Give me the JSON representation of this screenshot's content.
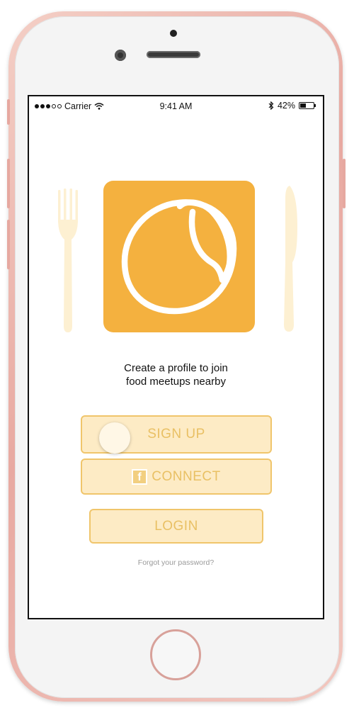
{
  "status_bar": {
    "carrier": "Carrier",
    "time": "9:41 AM",
    "battery": "42%",
    "battery_level": 0.42,
    "icons": [
      "signal-dots-icon",
      "wifi-icon",
      "bluetooth-icon",
      "battery-icon"
    ]
  },
  "hero": {
    "icons": [
      "fork-icon",
      "app-logo-icon",
      "knife-icon"
    ]
  },
  "tagline": {
    "line1": "Create a profile to join",
    "line2": "food meetups nearby"
  },
  "buttons": {
    "signup": "SIGN UP",
    "connect": "CONNECT",
    "login": "LOGIN"
  },
  "forgot_password": "Forgot your password?",
  "colors": {
    "brand_orange": "#f4b13f",
    "button_fill": "#fdebc5",
    "button_border": "#f0c56b",
    "button_text": "#e9c064",
    "utensil": "#fdf0d2",
    "phone_rose": "#e8a9a1"
  }
}
